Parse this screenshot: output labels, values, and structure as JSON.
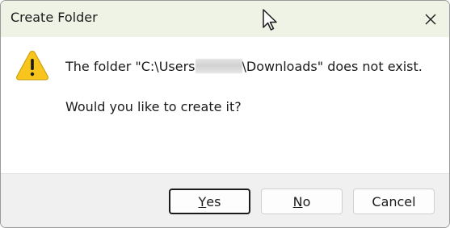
{
  "window": {
    "title": "Create Folder",
    "close_icon": "close-icon"
  },
  "message": {
    "icon": "warning-icon",
    "line1_prefix": "The folder \"C:\\Users",
    "line1_suffix": "\\Downloads\" does not exist.",
    "line2": "Would you like to create it?"
  },
  "buttons": {
    "yes": {
      "mnemonic": "Y",
      "rest": "es"
    },
    "no": {
      "mnemonic": "N",
      "rest": "o"
    },
    "cancel": {
      "label": "Cancel"
    }
  },
  "colors": {
    "titlebar_bg": "#eef3e6",
    "footer_bg": "#f0f0f0",
    "warning_fill": "#f8c51c"
  }
}
